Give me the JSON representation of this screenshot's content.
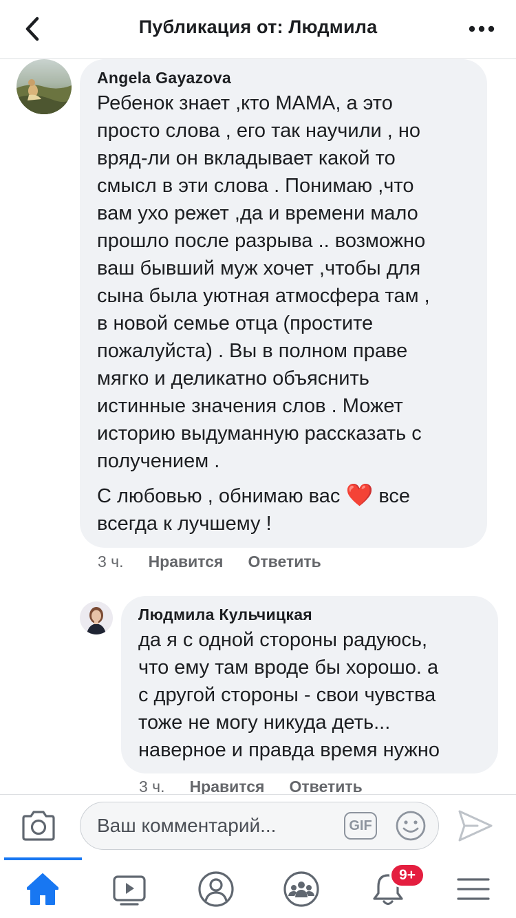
{
  "header": {
    "title": "Публикация от: Людмила",
    "back_icon": "chevron-left-icon",
    "more_icon": "more-dots-icon"
  },
  "comments": [
    {
      "author": "Angela Gayazova",
      "paragraph1_lines": [
        "Ребенок знает ,кто МАМА, а это",
        "просто слова , его так научили , но",
        "вряд-ли он вкладывает какой то",
        "смысл в эти слова . Понимаю ,что",
        "вам ухо режет ,да и времени мало",
        "прошло после разрыва .. возможно",
        "ваш бывший муж хочет ,чтобы для",
        "сына была уютная атмосфера там ,",
        "в новой семье отца (простите",
        "пожалуйста) . Вы в полном праве",
        "мягко и деликатно объяснить",
        "истинные значения слов . Может",
        "историю выдуманную рассказать с",
        "получением ."
      ],
      "paragraph2_part1": "С любовью , обнимаю вас",
      "paragraph2_emoji": "❤️",
      "paragraph2_part2": " все",
      "paragraph2_line2": "всегда к лучшему !",
      "time": "3 ч.",
      "like_label": "Нравится",
      "reply_label": "Ответить"
    },
    {
      "author": "Людмила Кульчицкая",
      "lines": [
        "да я с одной стороны радуюсь,",
        "что ему там вроде бы хорошо. а",
        "с другой стороны - свои чувства",
        "тоже не могу никуда деть...",
        "наверное и правда время нужно"
      ],
      "time": "3 ч.",
      "like_label": "Нравится",
      "reply_label": "Ответить"
    }
  ],
  "composer": {
    "placeholder": "Ваш комментарий...",
    "gif_label": "GIF",
    "camera_icon": "camera-icon",
    "emoji_icon": "smiley-icon",
    "send_icon": "send-icon"
  },
  "tabbar": {
    "tabs": [
      "home",
      "watch",
      "profile",
      "groups",
      "notifications",
      "menu"
    ],
    "active": "home",
    "notification_badge": "9+",
    "active_color": "#1877f2"
  }
}
